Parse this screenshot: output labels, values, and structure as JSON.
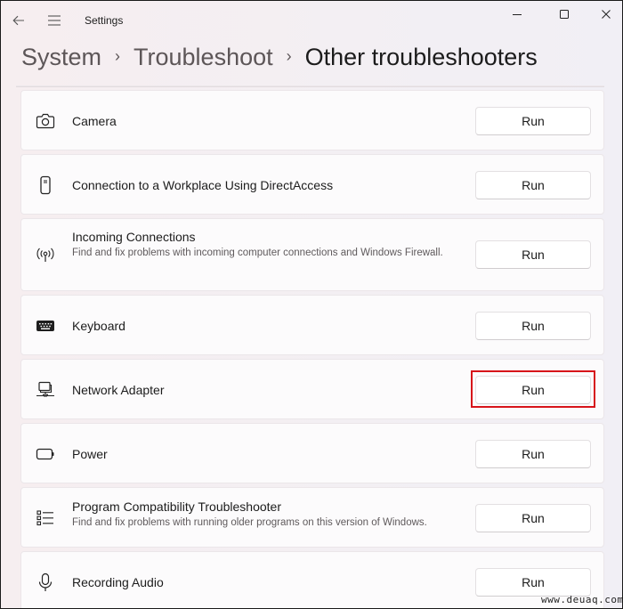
{
  "window": {
    "app_title": "Settings",
    "controls": {
      "minimize": "minimize-icon",
      "maximize": "maximize-icon",
      "close": "close-icon"
    },
    "nav": {
      "back": "back-arrow-icon",
      "menu": "hamburger-menu-icon"
    }
  },
  "breadcrumb": {
    "items": [
      "System",
      "Troubleshoot",
      "Other troubleshooters"
    ],
    "separator": "›"
  },
  "troubleshooters": [
    {
      "title": "Camera",
      "description": "",
      "icon": "camera-icon",
      "button": "Run",
      "highlighted": false
    },
    {
      "title": "Connection to a Workplace Using DirectAccess",
      "description": "",
      "icon": "device-phone-icon",
      "button": "Run",
      "highlighted": false
    },
    {
      "title": "Incoming Connections",
      "description": "Find and fix problems with incoming computer connections and Windows Firewall.",
      "icon": "antenna-icon",
      "button": "Run",
      "highlighted": false
    },
    {
      "title": "Keyboard",
      "description": "",
      "icon": "keyboard-icon",
      "button": "Run",
      "highlighted": false
    },
    {
      "title": "Network Adapter",
      "description": "",
      "icon": "network-computer-icon",
      "button": "Run",
      "highlighted": true
    },
    {
      "title": "Power",
      "description": "",
      "icon": "battery-icon",
      "button": "Run",
      "highlighted": false
    },
    {
      "title": "Program Compatibility Troubleshooter",
      "description": "Find and fix problems with running older programs on this version of Windows.",
      "icon": "list-icon",
      "button": "Run",
      "highlighted": false
    },
    {
      "title": "Recording Audio",
      "description": "",
      "icon": "microphone-icon",
      "button": "Run",
      "highlighted": false
    }
  ],
  "highlight_color": "#d7141a",
  "watermark": "www.deuaq.com"
}
